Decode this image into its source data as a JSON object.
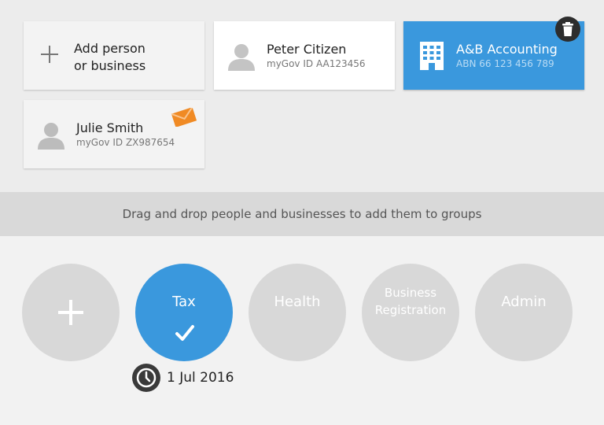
{
  "cards": {
    "add": {
      "line1": "Add person",
      "line2": "or business"
    },
    "people": [
      {
        "name": "Peter Citizen",
        "sub": "myGov ID AA123456"
      },
      {
        "name": "A&B Accounting",
        "sub": "ABN 66 123 456 789"
      },
      {
        "name": "Julie Smith",
        "sub": "myGov ID ZX987654"
      }
    ]
  },
  "dropbar": {
    "text": "Drag and drop people and businesses to add them to groups"
  },
  "groups": [
    {
      "label": ""
    },
    {
      "label": "Tax"
    },
    {
      "label": "Health"
    },
    {
      "label": "Business Registration"
    },
    {
      "label": "Admin"
    }
  ],
  "tax_group": {
    "date": "1 Jul 2016"
  },
  "colors": {
    "accent": "#3a98dd",
    "card_bg": "#ffffff",
    "inactive_group": "#d8d8d8",
    "envelope": "#f08a24",
    "dark": "#2d2d2d"
  },
  "icons": {
    "add": "plus-icon",
    "person": "person-icon",
    "business": "building-icon",
    "delete": "trash-icon",
    "message": "envelope-icon",
    "selected": "checkmark-icon",
    "date": "clock-icon"
  }
}
